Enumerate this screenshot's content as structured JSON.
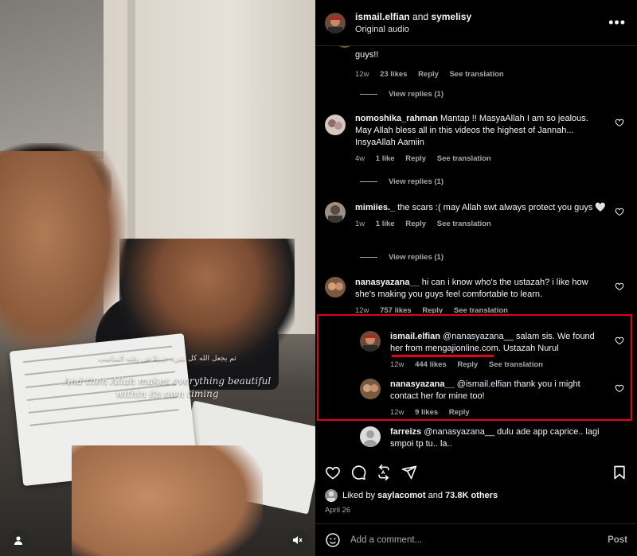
{
  "media": {
    "caption_arabic": "ثم يجعل الله كل شيء جميلا في وقته المناسب",
    "caption_english_1": "And then Allah makes everything beautiful",
    "caption_english_2": "within its own timing",
    "profile_icon": "person-icon",
    "mute_icon": "speaker-muted-icon"
  },
  "header": {
    "user1": "ismail.elfian",
    "and": " and ",
    "user2": "symelisy",
    "audio": "Original audio",
    "more_label": "•••"
  },
  "comments": [
    {
      "id": "top-partial",
      "text": "guys!!",
      "time": "12w",
      "likes": "23 likes",
      "reply": "Reply",
      "translation": "See translation",
      "view_replies": "View replies (1)"
    },
    {
      "id": "nomoshika",
      "user": "nomoshika_rahman",
      "text": "Mantap !! MasyaAllah I am so jealous. May Allah bless all in this videos the highest of Jannah... InsyaAllah Aamiin",
      "time": "4w",
      "likes": "1 like",
      "reply": "Reply",
      "translation": "See translation",
      "view_replies": "View replies (1)"
    },
    {
      "id": "mimiies",
      "user": "mimiies._",
      "text": "the scars :( may Allah swt always protect you guys 🤍",
      "time": "1w",
      "likes": "1 like",
      "reply": "Reply",
      "translation": "See translation",
      "view_replies": "View replies (1)"
    },
    {
      "id": "nanasyazana",
      "user": "nanasyazana__",
      "text": "hi can i know who's the ustazah? i like how she's making you guys feel comfortable to learn.",
      "time": "12w",
      "likes": "757 likes",
      "reply": "Reply",
      "translation": "See translation"
    },
    {
      "id": "reply-ismail",
      "user": "ismail.elfian",
      "mention": "@nanasyazana__",
      "text": "salam sis. We found her from mengajionline.com. Ustazah Nurul",
      "time": "12w",
      "likes": "444 likes",
      "reply": "Reply",
      "translation": "See translation"
    },
    {
      "id": "reply-nana",
      "user": "nanasyazana__",
      "mention": "@ismail.elfian",
      "text": "thank you i might contact her for mine too!",
      "time": "12w",
      "likes": "9 likes",
      "reply": "Reply"
    },
    {
      "id": "farreizs",
      "user": "farreizs",
      "mention": "@nanasyazana__",
      "text": "dulu ade app caprice.. lagi smpoi tp tu.. la.."
    }
  ],
  "actions": {
    "like_icon": "heart-icon",
    "comment_icon": "comment-icon",
    "repost_icon": "repost-icon",
    "share_icon": "send-icon",
    "save_icon": "bookmark-icon"
  },
  "likes": {
    "prefix": "Liked by ",
    "user": "saylacomot",
    "middle": " and ",
    "others": "73.8K others"
  },
  "date": "April 26",
  "composer": {
    "placeholder": "Add a comment...",
    "post_label": "Post",
    "emoji_icon": "smile-icon"
  },
  "colors": {
    "background": "#000000",
    "muted_text": "#a8a8a8",
    "highlight_box": "#e0001b"
  }
}
